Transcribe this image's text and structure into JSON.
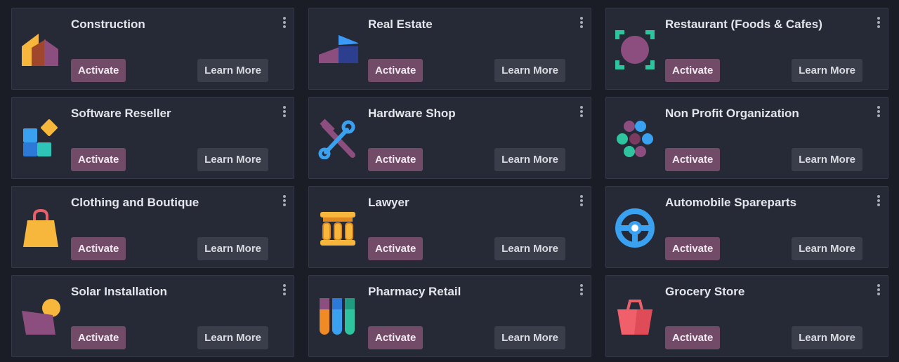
{
  "cards": [
    {
      "title": "Construction",
      "icon": "construction-icon",
      "activate_label": "Activate",
      "learn_label": "Learn More"
    },
    {
      "title": "Real Estate",
      "icon": "real-estate-icon",
      "activate_label": "Activate",
      "learn_label": "Learn More"
    },
    {
      "title": "Restaurant (Foods & Cafes)",
      "icon": "restaurant-icon",
      "activate_label": "Activate",
      "learn_label": "Learn More"
    },
    {
      "title": "Software Reseller",
      "icon": "software-reseller-icon",
      "activate_label": "Activate",
      "learn_label": "Learn More"
    },
    {
      "title": "Hardware Shop",
      "icon": "hardware-shop-icon",
      "activate_label": "Activate",
      "learn_label": "Learn More"
    },
    {
      "title": "Non Profit Organization",
      "icon": "non-profit-icon",
      "activate_label": "Activate",
      "learn_label": "Learn More"
    },
    {
      "title": "Clothing and Boutique",
      "icon": "clothing-boutique-icon",
      "activate_label": "Activate",
      "learn_label": "Learn More"
    },
    {
      "title": "Lawyer",
      "icon": "lawyer-icon",
      "activate_label": "Activate",
      "learn_label": "Learn More"
    },
    {
      "title": "Automobile Spareparts",
      "icon": "steering-wheel-icon",
      "activate_label": "Activate",
      "learn_label": "Learn More"
    },
    {
      "title": "Solar Installation",
      "icon": "solar-installation-icon",
      "activate_label": "Activate",
      "learn_label": "Learn More"
    },
    {
      "title": "Pharmacy Retail",
      "icon": "pharmacy-retail-icon",
      "activate_label": "Activate",
      "learn_label": "Learn More"
    },
    {
      "title": "Grocery Store",
      "icon": "grocery-store-icon",
      "activate_label": "Activate",
      "learn_label": "Learn More"
    }
  ],
  "colors": {
    "background": "#1b1d26",
    "card": "#262a36",
    "activate_button": "#714b67",
    "learn_more_button": "#3a3e4a"
  }
}
